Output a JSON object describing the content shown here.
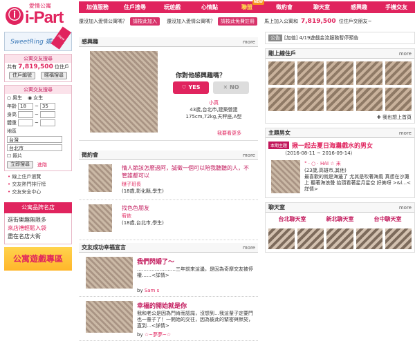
{
  "logo": {
    "sub": "愛情公寓",
    "main": "i-Part"
  },
  "nav": [
    {
      "label": "加值服務"
    },
    {
      "label": "住戶搜尋"
    },
    {
      "label": "玩遊戲"
    },
    {
      "label": "心情點"
    },
    {
      "label": "聯盟",
      "new": "NEW"
    },
    {
      "label": "徵約會"
    },
    {
      "label": "聊天室"
    },
    {
      "label": "感興趣"
    },
    {
      "label": "手機交友"
    }
  ],
  "subbar": {
    "t1": "還沒加入愛情公寓嗎？",
    "b1": "請按此加入",
    "t2": "還沒加入愛情公寓嗎？",
    "b2": "請按此免費註冊",
    "t3": "馬上加入公寓和",
    "count": "7,819,500",
    "t4": "位住戶交朋友~"
  },
  "left": {
    "sweet": "SweetRing 婚友網",
    "sweet_tag": "New",
    "search_title": "公寓交友搜尋",
    "total_pre": "共有",
    "total": "7,819,500",
    "total_suf": "位住戶",
    "btn_id": "住戶編號",
    "btn_nick": "暱稱搜尋",
    "adv_title": "公寓交友搜尋",
    "male": "男生",
    "female": "女生",
    "age": "年齡",
    "age_from": "18",
    "age_to": "35",
    "height": "身高",
    "weight": "體重",
    "area": "地區",
    "area1": "台灣",
    "area2": "台北市",
    "photo": "照片",
    "search_btn": "立即搜尋",
    "adv": "進階",
    "links": [
      "線上住戶瀏覽",
      "交友熱門排行榜",
      "交友安全中心"
    ],
    "shop_title": "公寓品牌名店",
    "shop_l1": "逛街樂趣無限多",
    "shop_l2": "來店禮輕鬆入袋",
    "shop_l3": "盡在名店大街",
    "banner": "公寓遊戲專區"
  },
  "interest": {
    "title": "感興趣",
    "more": "more",
    "q": "你對他感興趣嗎？",
    "yes": "YES",
    "no": "NO",
    "name": "小真",
    "info": "43歲,台北市,建築營建",
    "info2": "175cm,72kg,天秤座,A型",
    "more_link": "我要看更多"
  },
  "date": {
    "title": "徵約會",
    "more": "more",
    "items": [
      {
        "text": "情人節該怎麼過阿，誠徵一個可以陪我聽聽的人，不管誰都可以",
        "name": "瞇子班長",
        "info": "(18歲,彰化縣,學生)"
      },
      {
        "text": "找色色朋友",
        "name": "宥依",
        "info": "(18歲,台北市,學生)"
      }
    ]
  },
  "story": {
    "title": "交友成功幸福宣言",
    "more": "more",
    "items": [
      {
        "head": "我們閃婚了～",
        "text": "……………………三年前來這邊，是因為奇摩交友被停權……<詳情>",
        "by": "Sam s"
      },
      {
        "head": "幸福的開始就是你",
        "text": "我和老公是因為門肯而認識，沒想到…我這輩子定要門也一輩子了！一開始的交往，因為彼此的緊密與默契，直到…<詳情>",
        "by": "☆~夢夢~☆"
      }
    ]
  },
  "notice": {
    "tag": "公告",
    "text": "[加值] 4/19遊戲金流服務暫停預告"
  },
  "fresh": {
    "title": "剛上線住戶",
    "more": "more",
    "link": "我也想上首頁"
  },
  "theme": {
    "title": "主題男女",
    "more": "more",
    "tag": "本期主題",
    "head": "揪一起去夏日海灘戲水的男女",
    "date": "（2016-08-11 ~ 2016-09-14）",
    "name": "° ‧ ○ ‧ HAI ☆ 米",
    "info": "(23歲,高雄市,其他)",
    "text": "最喜歡的就是海邊了 尤其是吹著海風 真想在沙灘上 聽著海浪聲 抬頭看著星月星空 好美呀 >&l…<詳情>"
  },
  "chat": {
    "title": "聊天室",
    "more": "more",
    "rooms": [
      "台北聊天室",
      "新北聊天室",
      "台中聊天室"
    ]
  }
}
